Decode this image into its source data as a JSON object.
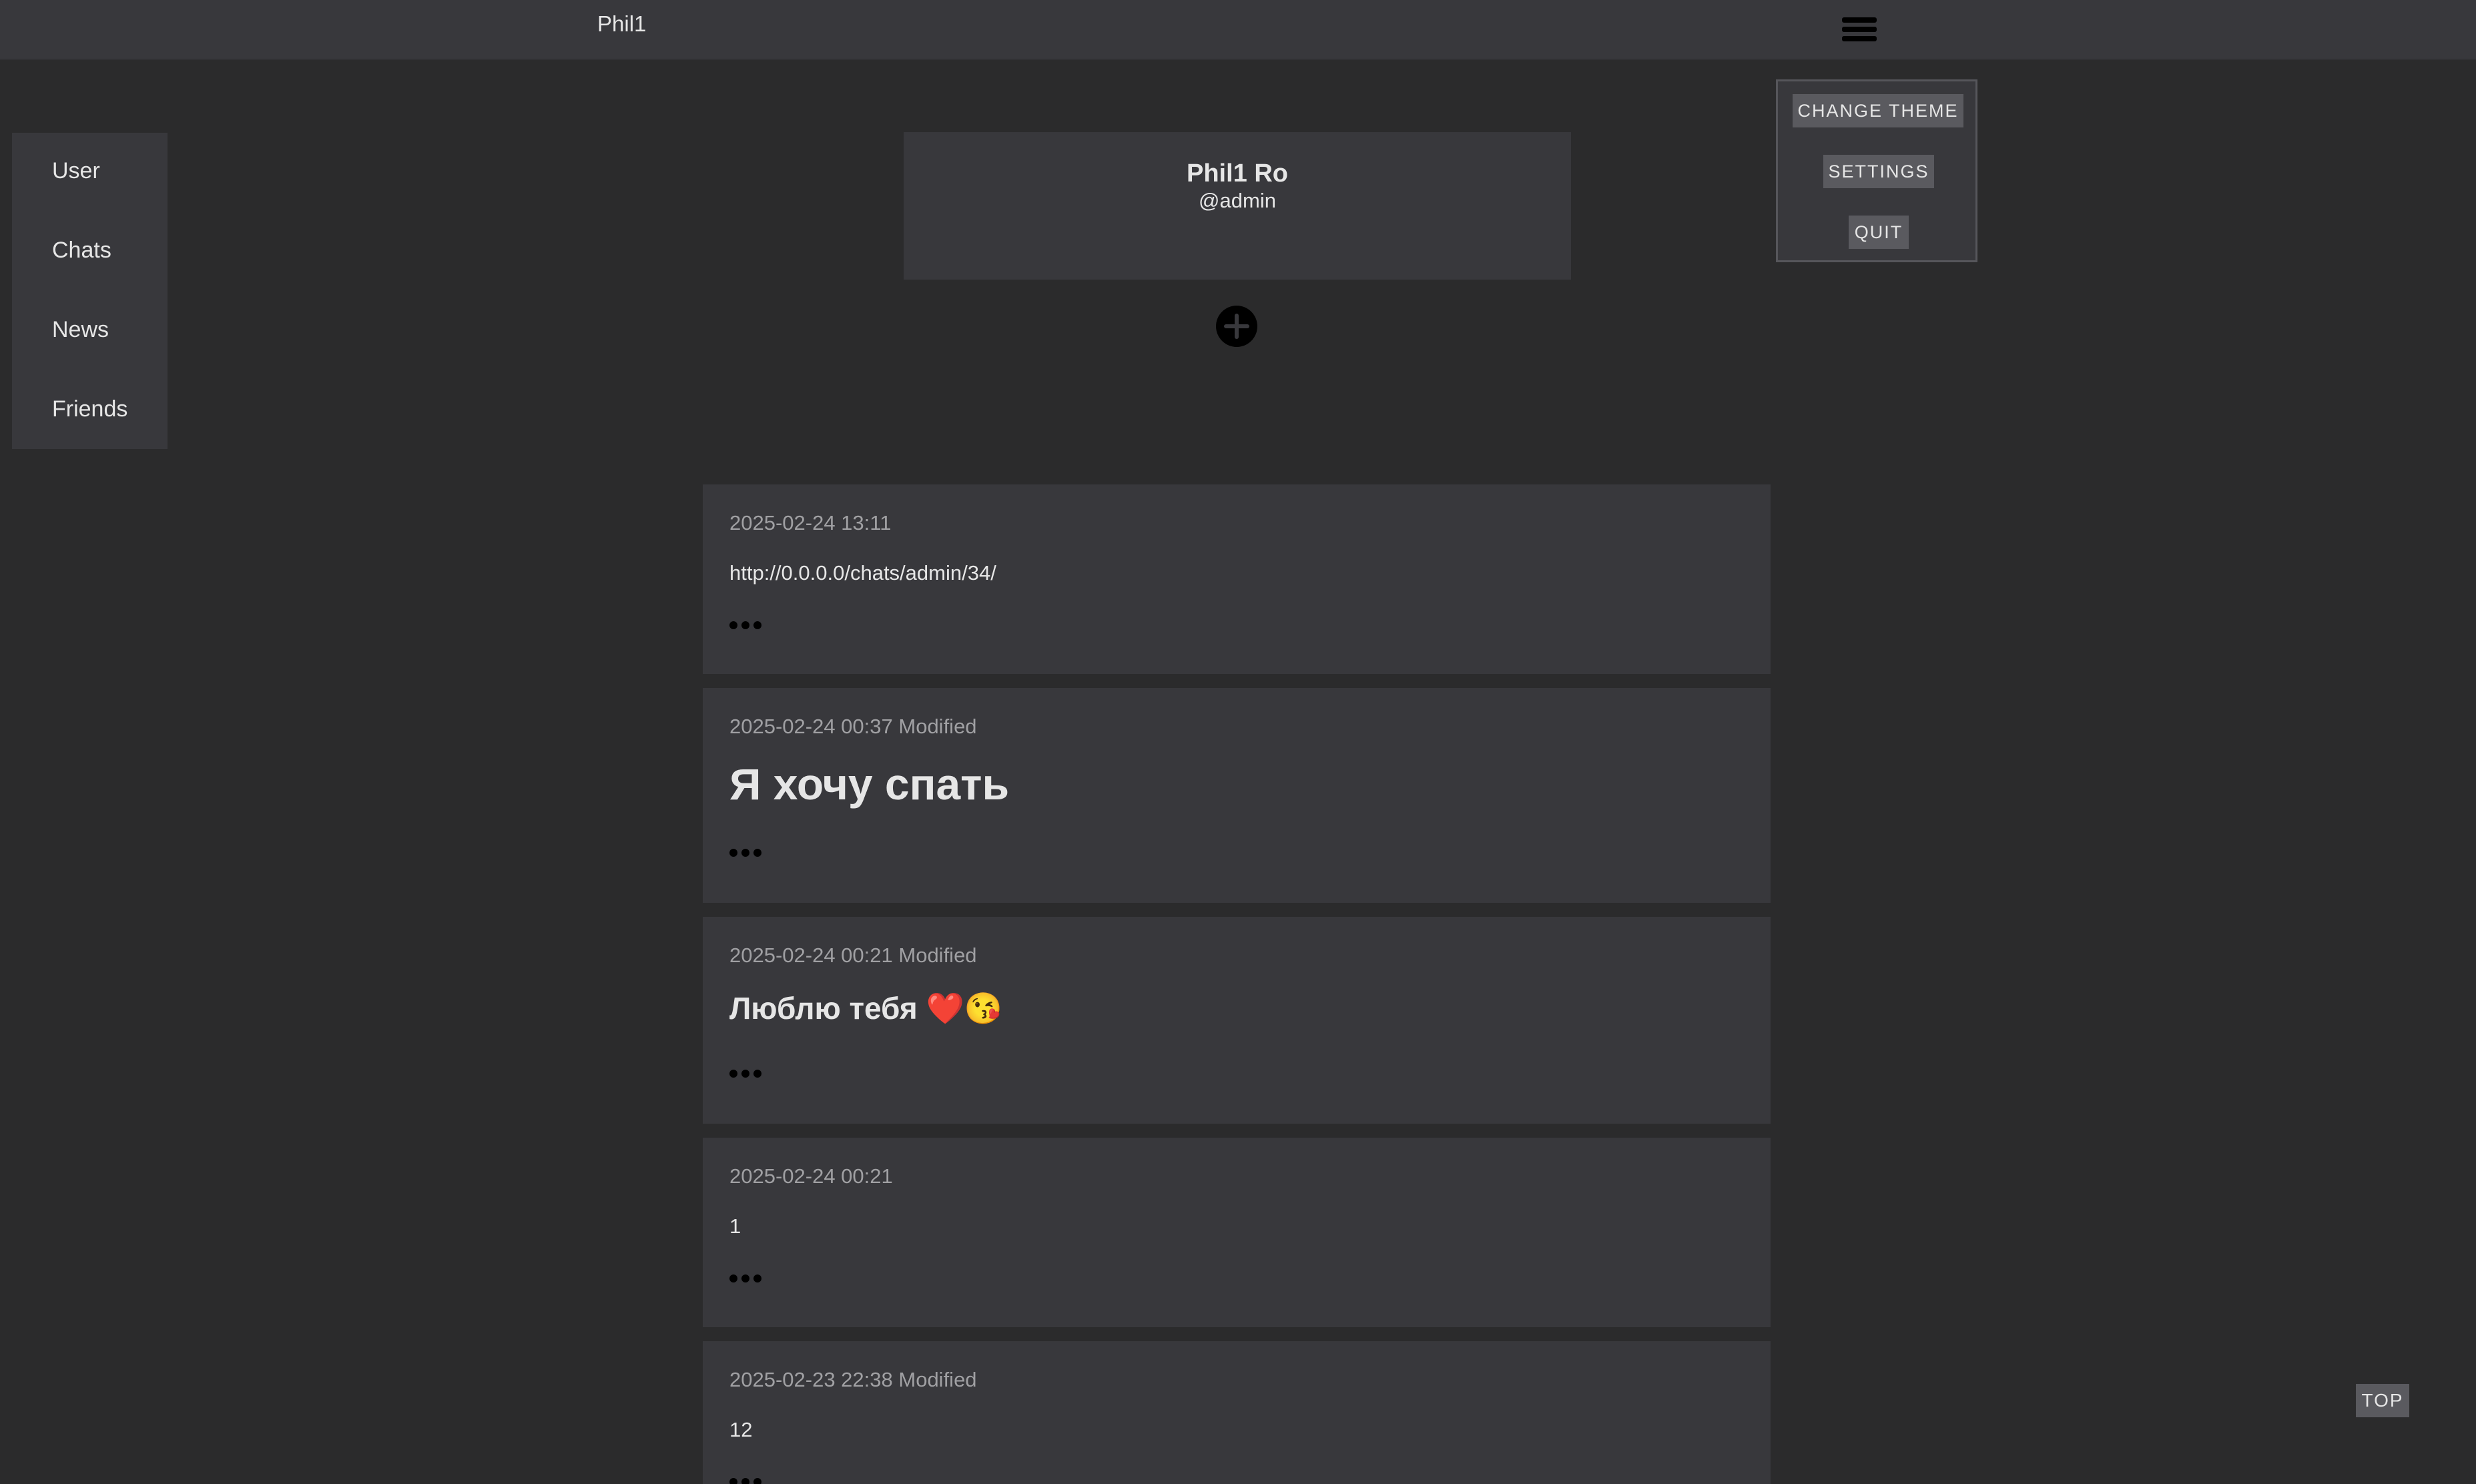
{
  "header": {
    "title": "Phil1",
    "menu_icon": "hamburger-menu-icon"
  },
  "dropdown": {
    "change_theme": "CHANGE THEME",
    "settings": "SETTINGS",
    "quit": "QUIT"
  },
  "sidebar": {
    "items": [
      {
        "label": "User"
      },
      {
        "label": "Chats"
      },
      {
        "label": "News"
      },
      {
        "label": "Friends"
      }
    ]
  },
  "profile": {
    "name": "Phil1 Ro",
    "handle": "@admin"
  },
  "add_button_icon": "plus-circle-icon",
  "posts": [
    {
      "meta": "2025-02-24 13:11",
      "body": "http://0.0.0.0/chats/admin/34/"
    },
    {
      "meta": "2025-02-24 00:37 Modified",
      "body": "Я хочу спать"
    },
    {
      "meta": "2025-02-24 00:21 Modified",
      "body": "Люблю тебя ❤️😘"
    },
    {
      "meta": "2025-02-24 00:21",
      "body": "1"
    },
    {
      "meta": "2025-02-23 22:38 Modified",
      "body": "12"
    }
  ],
  "top_button": "TOP",
  "colors": {
    "background": "#2b2b2c",
    "panel": "#38383c",
    "button": "#5a5a5f",
    "text": "#e6e6e6",
    "muted_text": "#a0a0a3"
  }
}
